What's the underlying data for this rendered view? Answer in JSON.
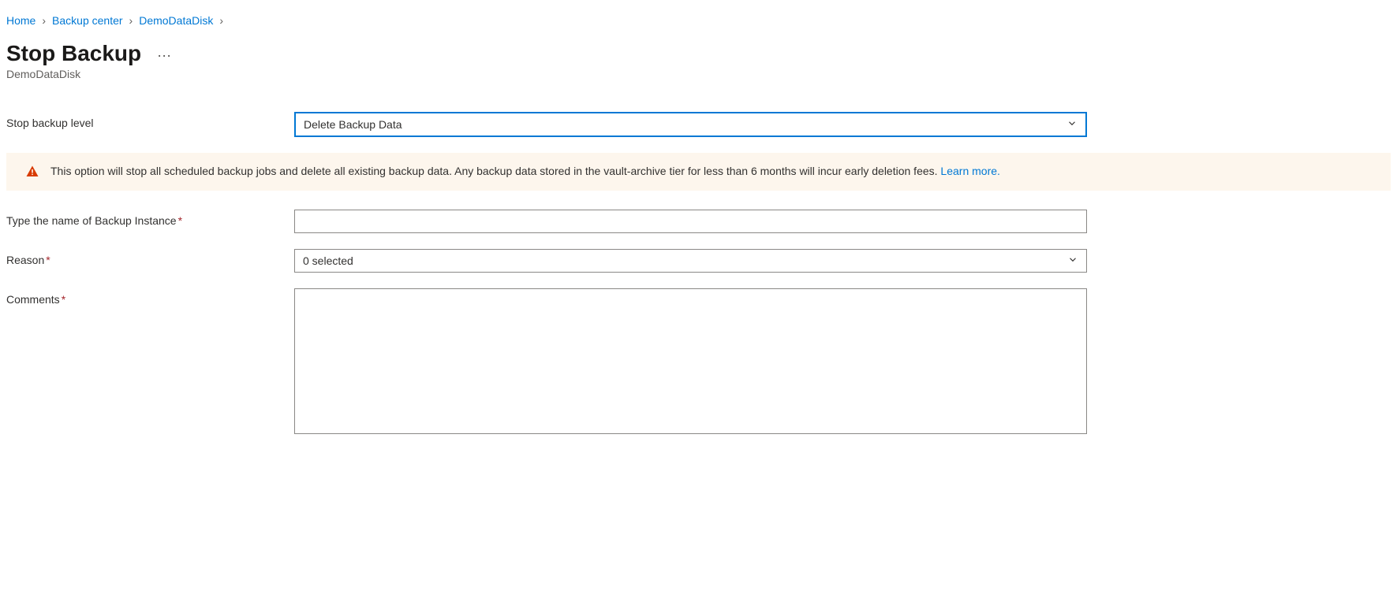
{
  "breadcrumb": {
    "items": [
      {
        "label": "Home"
      },
      {
        "label": "Backup center"
      },
      {
        "label": "DemoDataDisk"
      }
    ]
  },
  "header": {
    "title": "Stop Backup",
    "subtitle": "DemoDataDisk"
  },
  "form": {
    "stop_level_label": "Stop backup level",
    "stop_level_value": "Delete Backup Data",
    "name_label": "Type the name of Backup Instance",
    "name_value": "",
    "reason_label": "Reason",
    "reason_value": "0 selected",
    "comments_label": "Comments",
    "comments_value": ""
  },
  "warning": {
    "text": "This option will stop all scheduled backup jobs and delete all existing backup data. Any backup data stored in the vault-archive tier for less than 6 months will incur early deletion fees.",
    "link": "Learn more."
  }
}
